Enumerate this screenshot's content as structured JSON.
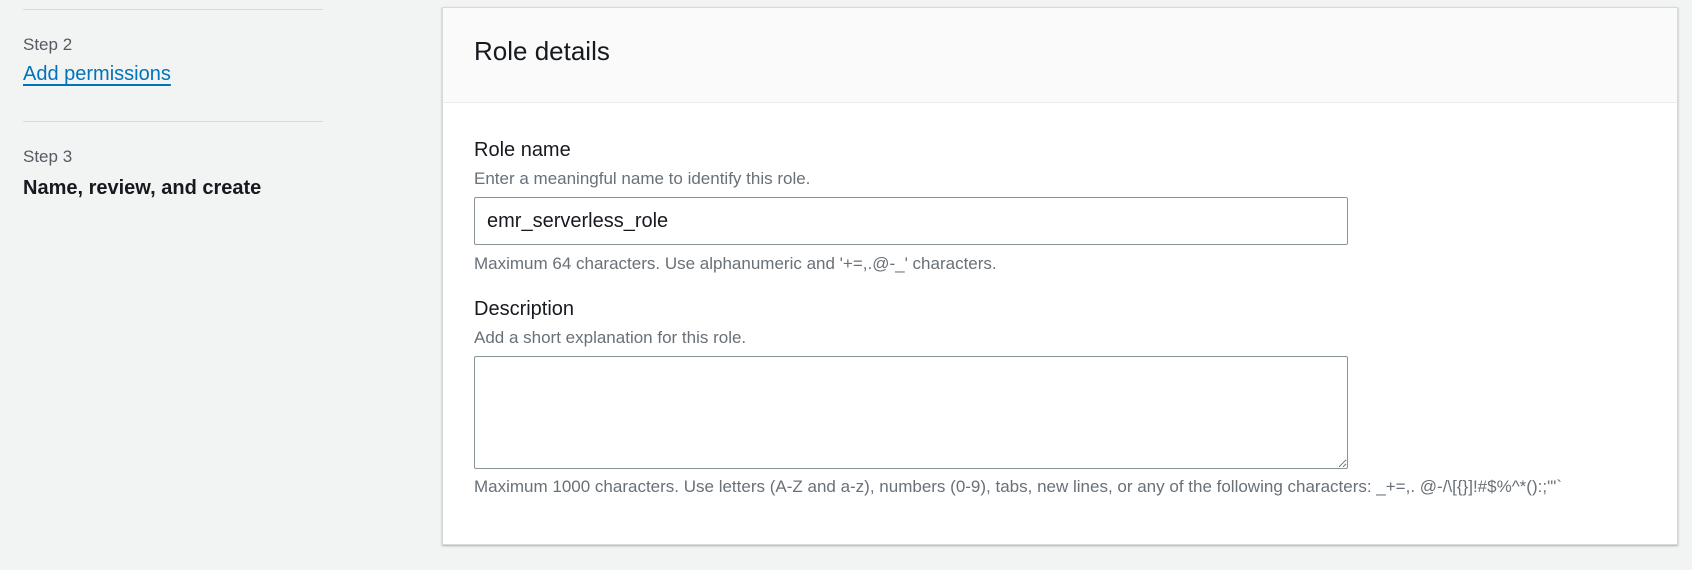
{
  "steps": [
    {
      "label": "Step 2",
      "title": "Add permissions",
      "state": "link"
    },
    {
      "label": "Step 3",
      "title": "Name, review, and create",
      "state": "current"
    }
  ],
  "panel": {
    "title": "Role details",
    "role_name": {
      "label": "Role name",
      "description": "Enter a meaningful name to identify this role.",
      "value": "emr_serverless_role",
      "constraint": "Maximum 64 characters. Use alphanumeric and '+=,.@-_' characters."
    },
    "description": {
      "label": "Description",
      "description": "Add a short explanation for this role.",
      "value": "",
      "constraint": "Maximum 1000 characters. Use letters (A-Z and a-z), numbers (0-9), tabs, new lines, or any of the following characters: _+=,. @-/\\[{}]!#$%^*():;'\"`"
    }
  },
  "colors": {
    "link": "#0073bb",
    "background": "#f2f3f3",
    "panel_header": "#fafafa"
  }
}
